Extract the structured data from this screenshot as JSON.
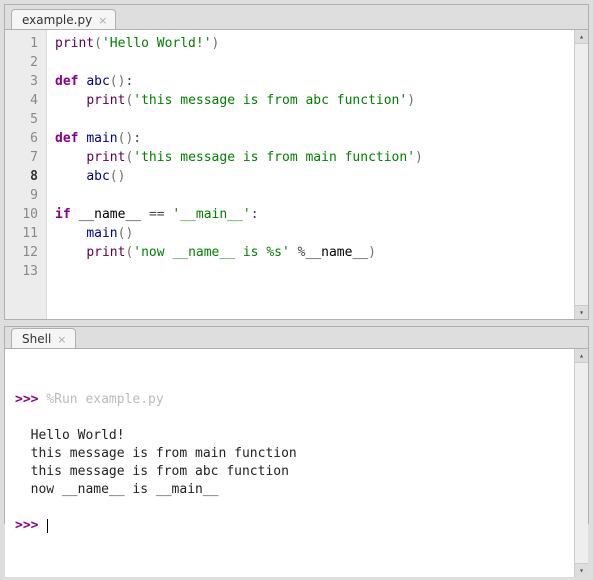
{
  "editor": {
    "tab_label": "example.py",
    "current_line": 8,
    "lines": [
      {
        "n": 1,
        "tokens": [
          {
            "c": "bi",
            "t": "print"
          },
          {
            "c": "par",
            "t": "("
          },
          {
            "c": "str",
            "t": "'Hello World!'"
          },
          {
            "c": "par",
            "t": ")"
          }
        ]
      },
      {
        "n": 2,
        "tokens": []
      },
      {
        "n": 3,
        "tokens": [
          {
            "c": "kw",
            "t": "def "
          },
          {
            "c": "fn",
            "t": "abc"
          },
          {
            "c": "par",
            "t": "()"
          },
          {
            "c": "pun",
            "t": ":"
          }
        ]
      },
      {
        "n": 4,
        "tokens": [
          {
            "c": "",
            "t": "    "
          },
          {
            "c": "bi",
            "t": "print"
          },
          {
            "c": "par",
            "t": "("
          },
          {
            "c": "str",
            "t": "'this message is from abc function'"
          },
          {
            "c": "par",
            "t": ")"
          }
        ]
      },
      {
        "n": 5,
        "tokens": []
      },
      {
        "n": 6,
        "tokens": [
          {
            "c": "kw",
            "t": "def "
          },
          {
            "c": "fn",
            "t": "main"
          },
          {
            "c": "par",
            "t": "()"
          },
          {
            "c": "pun",
            "t": ":"
          }
        ]
      },
      {
        "n": 7,
        "tokens": [
          {
            "c": "",
            "t": "    "
          },
          {
            "c": "bi",
            "t": "print"
          },
          {
            "c": "par",
            "t": "("
          },
          {
            "c": "str",
            "t": "'this message is from main function'"
          },
          {
            "c": "par",
            "t": ")"
          }
        ]
      },
      {
        "n": 8,
        "tokens": [
          {
            "c": "",
            "t": "    "
          },
          {
            "c": "fn",
            "t": "abc"
          },
          {
            "c": "par",
            "t": "()"
          }
        ]
      },
      {
        "n": 9,
        "tokens": []
      },
      {
        "n": 10,
        "tokens": [
          {
            "c": "kw",
            "t": "if"
          },
          {
            "c": "",
            "t": " __name__ "
          },
          {
            "c": "op",
            "t": "=="
          },
          {
            "c": "",
            "t": " "
          },
          {
            "c": "str",
            "t": "'__main__'"
          },
          {
            "c": "pun",
            "t": ":"
          }
        ]
      },
      {
        "n": 11,
        "tokens": [
          {
            "c": "",
            "t": "    "
          },
          {
            "c": "fn",
            "t": "main"
          },
          {
            "c": "par",
            "t": "()"
          }
        ]
      },
      {
        "n": 12,
        "tokens": [
          {
            "c": "",
            "t": "    "
          },
          {
            "c": "bi",
            "t": "print"
          },
          {
            "c": "par",
            "t": "("
          },
          {
            "c": "str",
            "t": "'now __name__ is %s'"
          },
          {
            "c": "",
            "t": " "
          },
          {
            "c": "op",
            "t": "%"
          },
          {
            "c": "",
            "t": "__name__"
          },
          {
            "c": "par",
            "t": ")"
          }
        ]
      },
      {
        "n": 13,
        "tokens": []
      }
    ]
  },
  "shell": {
    "tab_label": "Shell",
    "prompt": ">>> ",
    "run_command": "%Run example.py",
    "output": [
      "Hello World!",
      "this message is from main function",
      "this message is from abc function",
      "now __name__ is __main__"
    ]
  }
}
